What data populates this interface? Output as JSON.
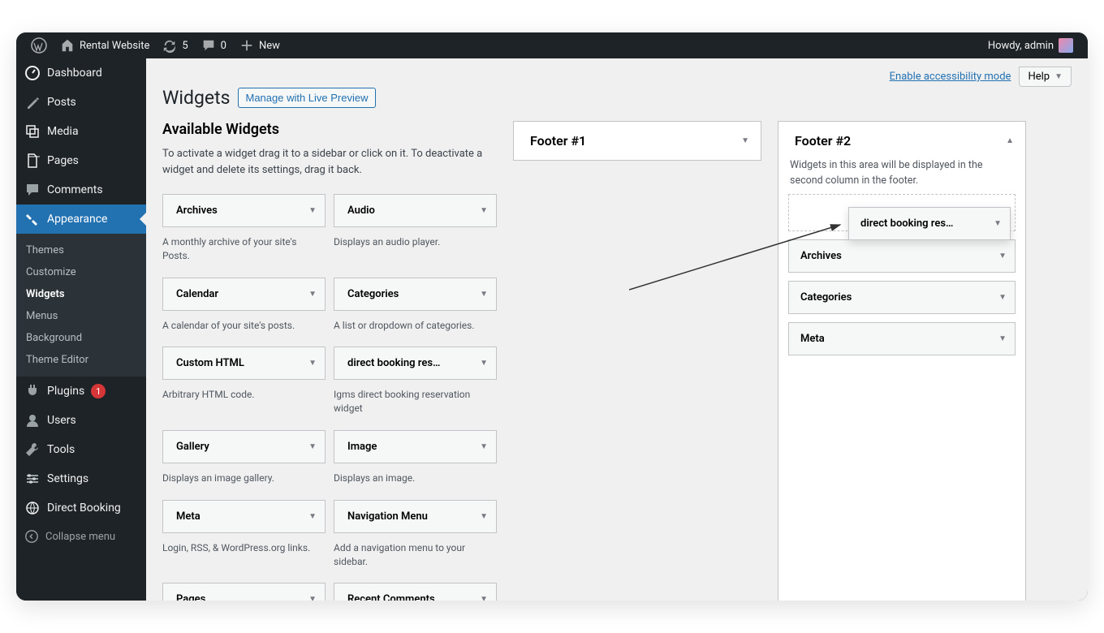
{
  "adminbar": {
    "site_name": "Rental Website",
    "updates": "5",
    "comments": "0",
    "new": "New",
    "howdy": "Howdy, admin"
  },
  "sidebar": {
    "dashboard": "Dashboard",
    "posts": "Posts",
    "media": "Media",
    "pages": "Pages",
    "comments": "Comments",
    "appearance": "Appearance",
    "appearance_sub": {
      "themes": "Themes",
      "customize": "Customize",
      "widgets": "Widgets",
      "menus": "Menus",
      "background": "Background",
      "theme_editor": "Theme Editor"
    },
    "plugins": "Plugins",
    "plugins_badge": "1",
    "users": "Users",
    "tools": "Tools",
    "settings": "Settings",
    "direct_booking": "Direct Booking",
    "collapse": "Collapse menu"
  },
  "toprow": {
    "access": "Enable accessibility mode",
    "help": "Help"
  },
  "head": {
    "title": "Widgets",
    "live": "Manage with Live Preview"
  },
  "available": {
    "title": "Available Widgets",
    "desc": "To activate a widget drag it to a sidebar or click on it. To deactivate a widget and delete its settings, drag it back.",
    "widgets": [
      {
        "title": "Archives",
        "desc": "A monthly archive of your site's Posts."
      },
      {
        "title": "Audio",
        "desc": "Displays an audio player."
      },
      {
        "title": "Calendar",
        "desc": "A calendar of your site's posts."
      },
      {
        "title": "Categories",
        "desc": "A list or dropdown of categories."
      },
      {
        "title": "Custom HTML",
        "desc": "Arbitrary HTML code."
      },
      {
        "title": "direct booking res…",
        "desc": "Igms direct booking reserva­tion widget"
      },
      {
        "title": "Gallery",
        "desc": "Displays an image gallery."
      },
      {
        "title": "Image",
        "desc": "Displays an image."
      },
      {
        "title": "Meta",
        "desc": "Login, RSS, & WordPress.org links."
      },
      {
        "title": "Navigation Menu",
        "desc": "Add a navigation menu to your sidebar."
      },
      {
        "title": "Pages",
        "desc": ""
      },
      {
        "title": "Recent Comments",
        "desc": ""
      }
    ]
  },
  "footer1": {
    "title": "Footer #1"
  },
  "footer2": {
    "title": "Footer #2",
    "desc": "Widgets in this area will be displayed in the second column in the footer.",
    "widgets": [
      "Archives",
      "Categories",
      "Meta"
    ]
  },
  "dragging": {
    "title": "direct booking res…"
  }
}
